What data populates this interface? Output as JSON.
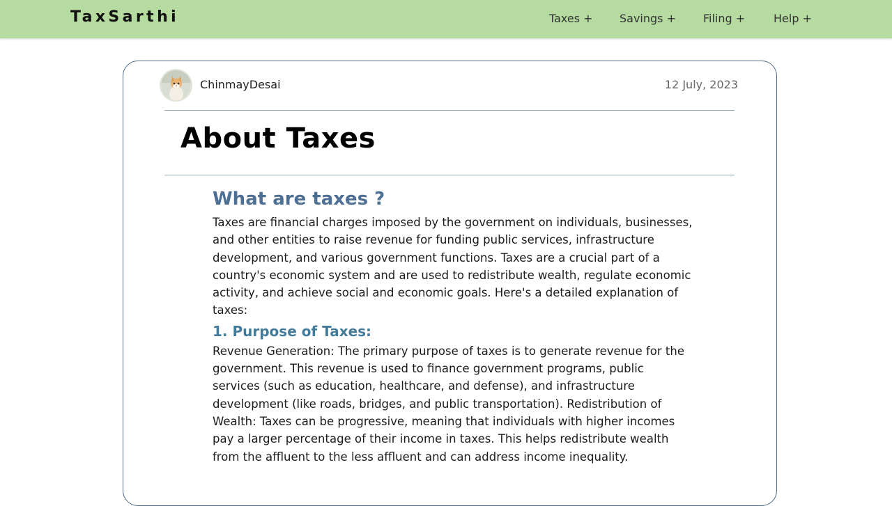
{
  "nav": {
    "brand": "TaxSarthi",
    "items": [
      {
        "label": "Taxes +"
      },
      {
        "label": "Savings +"
      },
      {
        "label": "Filing +"
      },
      {
        "label": "Help +"
      }
    ]
  },
  "post": {
    "author": "ChinmayDesai",
    "date": "12 July, 2023",
    "title": "About Taxes",
    "section_heading": "What are taxes ?",
    "intro": "Taxes are financial charges imposed by the government on individuals, businesses, and other entities to raise revenue for funding public services, infrastructure development, and various government functions. Taxes are a crucial part of a country's economic system and are used to redistribute wealth, regulate economic activity, and achieve social and economic goals. Here's a detailed explanation of taxes:",
    "sub_heading": "1. Purpose of Taxes:",
    "body": "Revenue Generation: The primary purpose of taxes is to generate revenue for the government. This revenue is used to finance government programs, public services (such as education, healthcare, and defense), and infrastructure development (like roads, bridges, and public transportation). Redistribution of Wealth: Taxes can be progressive, meaning that individuals with higher incomes pay a larger percentage of their income in taxes. This helps redistribute wealth from the affluent to the less affluent and can address income inequality."
  },
  "colors": {
    "navbar_bg": "#b5dba0",
    "heading_blue": "#4e6f94",
    "subheading_blue": "#437b9a",
    "card_border": "#4e6b85"
  }
}
